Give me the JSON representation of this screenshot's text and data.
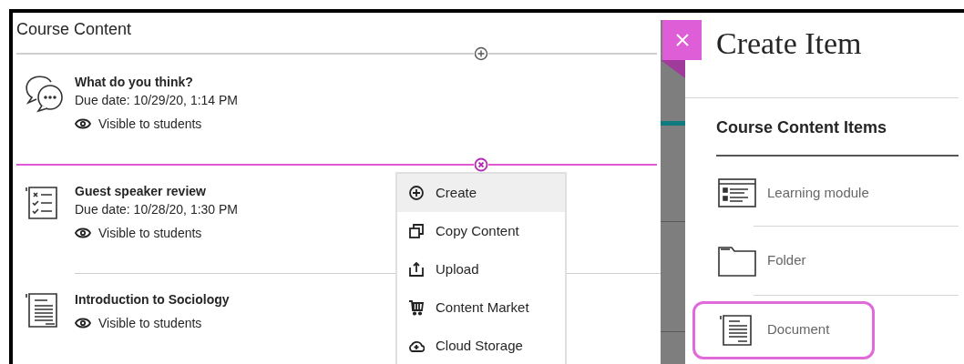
{
  "course_content": {
    "title": "Course Content",
    "items": [
      {
        "kind": "discussion",
        "title": "What do you think?",
        "due": "Due date: 10/29/20, 1:14 PM",
        "visibility": "Visible to students"
      },
      {
        "kind": "test",
        "title": "Guest speaker review",
        "due": "Due date: 10/28/20, 1:30 PM",
        "visibility": "Visible to students"
      },
      {
        "kind": "document",
        "title": "Introduction to Sociology",
        "visibility": "Visible to students"
      }
    ]
  },
  "add_menu": {
    "items": [
      {
        "kind": "create",
        "label": "Create",
        "selected": true
      },
      {
        "kind": "copy",
        "label": "Copy Content",
        "selected": false
      },
      {
        "kind": "upload",
        "label": "Upload",
        "selected": false
      },
      {
        "kind": "market",
        "label": "Content Market",
        "selected": false
      },
      {
        "kind": "cloud",
        "label": "Cloud Storage",
        "selected": false
      }
    ]
  },
  "create_panel": {
    "title": "Create Item",
    "section": "Course Content Items",
    "items": [
      {
        "kind": "module",
        "label": "Learning module",
        "selected": false
      },
      {
        "kind": "folder",
        "label": "Folder",
        "selected": false
      },
      {
        "kind": "document",
        "label": "Document",
        "selected": true
      }
    ]
  }
}
